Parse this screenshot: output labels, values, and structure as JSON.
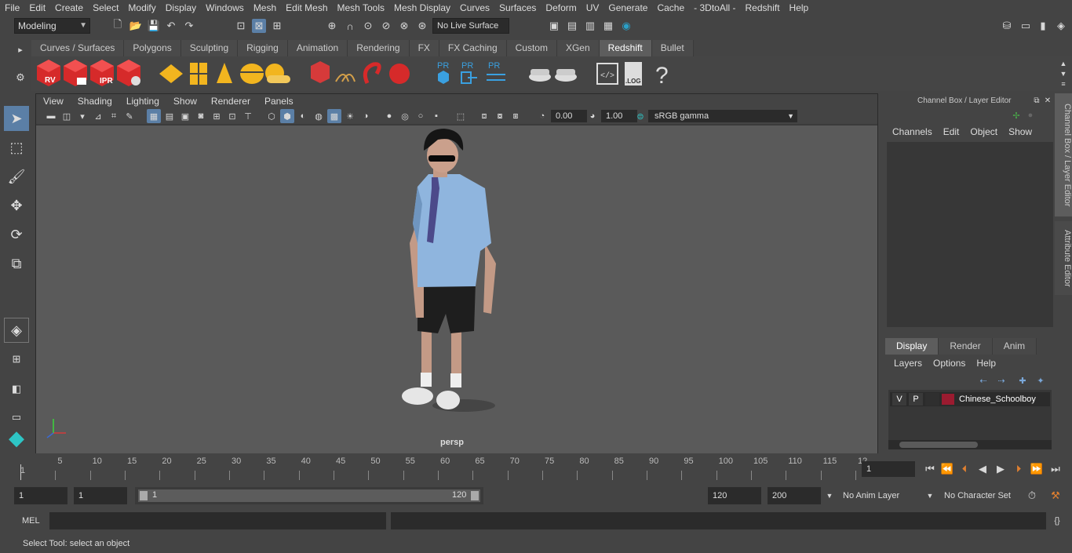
{
  "menubar": {
    "items": [
      "File",
      "Edit",
      "Create",
      "Select",
      "Modify",
      "Display",
      "Windows",
      "Mesh",
      "Edit Mesh",
      "Mesh Tools",
      "Mesh Display",
      "Curves",
      "Surfaces",
      "Deform",
      "UV",
      "Generate",
      "Cache",
      "- 3DtoAll -",
      "Redshift",
      "Help"
    ]
  },
  "statusline": {
    "mode": "Modeling",
    "live_surface": "No Live Surface"
  },
  "shelf": {
    "tabs": [
      "Curves / Surfaces",
      "Polygons",
      "Sculpting",
      "Rigging",
      "Animation",
      "Rendering",
      "FX",
      "FX Caching",
      "Custom",
      "XGen",
      "Redshift",
      "Bullet"
    ],
    "active_tab": "Redshift",
    "icon_labels": [
      "RV",
      "IPR",
      "PR",
      "PR",
      "PR",
      ".LOG",
      "?"
    ]
  },
  "viewport": {
    "menu": [
      "View",
      "Shading",
      "Lighting",
      "Show",
      "Renderer",
      "Panels"
    ],
    "exposure": "0.00",
    "gamma": "1.00",
    "color_space": "sRGB gamma",
    "camera_label": "persp"
  },
  "channel_box": {
    "title": "Channel Box / Layer Editor",
    "menu": [
      "Channels",
      "Edit",
      "Object",
      "Show"
    ]
  },
  "layer_editor": {
    "tabs": [
      "Display",
      "Render",
      "Anim"
    ],
    "active_tab": "Display",
    "menu": [
      "Layers",
      "Options",
      "Help"
    ],
    "layers": [
      {
        "v": "V",
        "p": "P",
        "name": "Chinese_Schoolboy",
        "color": "#9b1b30"
      }
    ]
  },
  "side_tabs": [
    "Channel Box / Layer Editor",
    "Attribute Editor"
  ],
  "timeline": {
    "tick_labels": [
      "5",
      "10",
      "15",
      "20",
      "25",
      "30",
      "35",
      "40",
      "45",
      "50",
      "55",
      "60",
      "65",
      "70",
      "75",
      "80",
      "85",
      "90",
      "95",
      "100",
      "105",
      "110",
      "115",
      "12"
    ],
    "start_label": "1",
    "current_frame": "1"
  },
  "range": {
    "start_field": "1",
    "playback_start": "1",
    "range_start_label": "1",
    "range_end_label": "120",
    "playback_end": "120",
    "end_field": "200",
    "anim_layer": "No Anim Layer",
    "character_set": "No Character Set"
  },
  "command_line": {
    "language": "MEL"
  },
  "help_line": {
    "text": "Select Tool: select an object"
  },
  "colors": {
    "accent": "#5b7fa6",
    "layer_color": "#9b1b30"
  }
}
